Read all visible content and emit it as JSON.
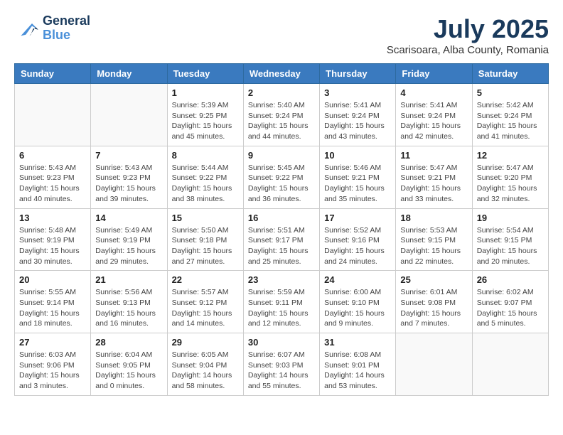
{
  "header": {
    "logo_line1": "General",
    "logo_line2": "Blue",
    "month": "July 2025",
    "location": "Scarisoara, Alba County, Romania"
  },
  "weekdays": [
    "Sunday",
    "Monday",
    "Tuesday",
    "Wednesday",
    "Thursday",
    "Friday",
    "Saturday"
  ],
  "weeks": [
    [
      {
        "day": "",
        "info": ""
      },
      {
        "day": "",
        "info": ""
      },
      {
        "day": "1",
        "info": "Sunrise: 5:39 AM\nSunset: 9:25 PM\nDaylight: 15 hours and 45 minutes."
      },
      {
        "day": "2",
        "info": "Sunrise: 5:40 AM\nSunset: 9:24 PM\nDaylight: 15 hours and 44 minutes."
      },
      {
        "day": "3",
        "info": "Sunrise: 5:41 AM\nSunset: 9:24 PM\nDaylight: 15 hours and 43 minutes."
      },
      {
        "day": "4",
        "info": "Sunrise: 5:41 AM\nSunset: 9:24 PM\nDaylight: 15 hours and 42 minutes."
      },
      {
        "day": "5",
        "info": "Sunrise: 5:42 AM\nSunset: 9:24 PM\nDaylight: 15 hours and 41 minutes."
      }
    ],
    [
      {
        "day": "6",
        "info": "Sunrise: 5:43 AM\nSunset: 9:23 PM\nDaylight: 15 hours and 40 minutes."
      },
      {
        "day": "7",
        "info": "Sunrise: 5:43 AM\nSunset: 9:23 PM\nDaylight: 15 hours and 39 minutes."
      },
      {
        "day": "8",
        "info": "Sunrise: 5:44 AM\nSunset: 9:22 PM\nDaylight: 15 hours and 38 minutes."
      },
      {
        "day": "9",
        "info": "Sunrise: 5:45 AM\nSunset: 9:22 PM\nDaylight: 15 hours and 36 minutes."
      },
      {
        "day": "10",
        "info": "Sunrise: 5:46 AM\nSunset: 9:21 PM\nDaylight: 15 hours and 35 minutes."
      },
      {
        "day": "11",
        "info": "Sunrise: 5:47 AM\nSunset: 9:21 PM\nDaylight: 15 hours and 33 minutes."
      },
      {
        "day": "12",
        "info": "Sunrise: 5:47 AM\nSunset: 9:20 PM\nDaylight: 15 hours and 32 minutes."
      }
    ],
    [
      {
        "day": "13",
        "info": "Sunrise: 5:48 AM\nSunset: 9:19 PM\nDaylight: 15 hours and 30 minutes."
      },
      {
        "day": "14",
        "info": "Sunrise: 5:49 AM\nSunset: 9:19 PM\nDaylight: 15 hours and 29 minutes."
      },
      {
        "day": "15",
        "info": "Sunrise: 5:50 AM\nSunset: 9:18 PM\nDaylight: 15 hours and 27 minutes."
      },
      {
        "day": "16",
        "info": "Sunrise: 5:51 AM\nSunset: 9:17 PM\nDaylight: 15 hours and 25 minutes."
      },
      {
        "day": "17",
        "info": "Sunrise: 5:52 AM\nSunset: 9:16 PM\nDaylight: 15 hours and 24 minutes."
      },
      {
        "day": "18",
        "info": "Sunrise: 5:53 AM\nSunset: 9:15 PM\nDaylight: 15 hours and 22 minutes."
      },
      {
        "day": "19",
        "info": "Sunrise: 5:54 AM\nSunset: 9:15 PM\nDaylight: 15 hours and 20 minutes."
      }
    ],
    [
      {
        "day": "20",
        "info": "Sunrise: 5:55 AM\nSunset: 9:14 PM\nDaylight: 15 hours and 18 minutes."
      },
      {
        "day": "21",
        "info": "Sunrise: 5:56 AM\nSunset: 9:13 PM\nDaylight: 15 hours and 16 minutes."
      },
      {
        "day": "22",
        "info": "Sunrise: 5:57 AM\nSunset: 9:12 PM\nDaylight: 15 hours and 14 minutes."
      },
      {
        "day": "23",
        "info": "Sunrise: 5:59 AM\nSunset: 9:11 PM\nDaylight: 15 hours and 12 minutes."
      },
      {
        "day": "24",
        "info": "Sunrise: 6:00 AM\nSunset: 9:10 PM\nDaylight: 15 hours and 9 minutes."
      },
      {
        "day": "25",
        "info": "Sunrise: 6:01 AM\nSunset: 9:08 PM\nDaylight: 15 hours and 7 minutes."
      },
      {
        "day": "26",
        "info": "Sunrise: 6:02 AM\nSunset: 9:07 PM\nDaylight: 15 hours and 5 minutes."
      }
    ],
    [
      {
        "day": "27",
        "info": "Sunrise: 6:03 AM\nSunset: 9:06 PM\nDaylight: 15 hours and 3 minutes."
      },
      {
        "day": "28",
        "info": "Sunrise: 6:04 AM\nSunset: 9:05 PM\nDaylight: 15 hours and 0 minutes."
      },
      {
        "day": "29",
        "info": "Sunrise: 6:05 AM\nSunset: 9:04 PM\nDaylight: 14 hours and 58 minutes."
      },
      {
        "day": "30",
        "info": "Sunrise: 6:07 AM\nSunset: 9:03 PM\nDaylight: 14 hours and 55 minutes."
      },
      {
        "day": "31",
        "info": "Sunrise: 6:08 AM\nSunset: 9:01 PM\nDaylight: 14 hours and 53 minutes."
      },
      {
        "day": "",
        "info": ""
      },
      {
        "day": "",
        "info": ""
      }
    ]
  ]
}
